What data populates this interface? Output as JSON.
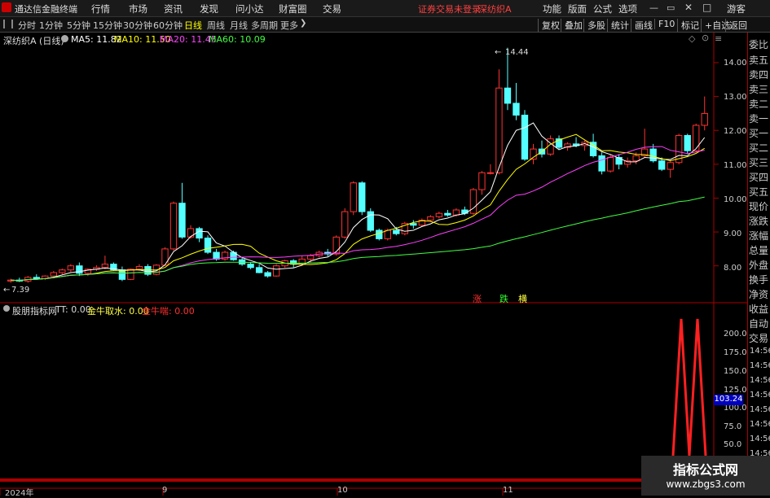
{
  "app": {
    "title": "通达信金融终端"
  },
  "menu": [
    "行情",
    "市场",
    "资讯",
    "发现",
    "问小达",
    "财富圈",
    "交易"
  ],
  "status": {
    "warning": "证券交易未登录",
    "stock": "深纺织A"
  },
  "right_menu": [
    "功能",
    "版面",
    "公式",
    "选项"
  ],
  "user": "游客",
  "periods": [
    "分时",
    "1分钟",
    "5分钟",
    "15分钟",
    "30分钟",
    "60分钟",
    "日线",
    "周线",
    "月线",
    "多周期",
    "更多"
  ],
  "active_period": "日线",
  "toolbar_right": [
    "复权",
    "叠加",
    "多股",
    "统计",
    "画线",
    "F10",
    "标记",
    "+自选",
    "返回"
  ],
  "main_chart": {
    "title": "深纺织A (日线)",
    "ma": [
      {
        "label": "MA5: 11.82",
        "color": "#ffffff"
      },
      {
        "label": "MA10: 11.50",
        "color": "#ffff00"
      },
      {
        "label": "MA20: 11.45",
        "color": "#ff40ff"
      },
      {
        "label": "MA60: 10.09",
        "color": "#40ff40"
      }
    ],
    "y_ticks": [
      "14.00",
      "13.00",
      "12.00",
      "11.00",
      "10.00",
      "9.00",
      "8.00"
    ],
    "high_label": "14.44",
    "low_label": "7.39",
    "markers": [
      {
        "text": "涨",
        "color": "#ff3030"
      },
      {
        "text": "跌",
        "color": "#30ff30"
      },
      {
        "text": "横",
        "color": "#ffff40"
      }
    ]
  },
  "sub_chart": {
    "title": "股朋指标网",
    "tt": "TT: 0.00",
    "g1": "金牛取水: 0.00",
    "g2": "金牛喘: 0.00",
    "y_ticks": [
      "200.0",
      "175.0",
      "150.0",
      "125.0",
      "100.0",
      "75.0",
      "50.0"
    ],
    "cursor_value": "103.24"
  },
  "x_labels": [
    "2024年",
    "9",
    "10",
    "11"
  ],
  "side_panel": [
    "委比",
    "卖五",
    "卖四",
    "卖三",
    "卖二",
    "卖一",
    "买一",
    "买二",
    "买三",
    "买四",
    "买五",
    "现价",
    "涨跌",
    "涨幅",
    "总量",
    "外盘",
    "换手",
    "净资",
    "收益",
    "自动",
    "交易"
  ],
  "times": [
    "14:56",
    "14:56",
    "14:56",
    "14:56",
    "14:56",
    "14:56",
    "14:56",
    "14:56"
  ],
  "watermark": {
    "line1": "指标公式网",
    "line2": "www.zbgs3.com"
  },
  "chart_data": {
    "type": "candlestick",
    "ylim": [
      7.2,
      14.6
    ],
    "candles": [
      [
        7.55,
        7.62,
        7.5,
        7.58
      ],
      [
        7.58,
        7.65,
        7.52,
        7.55
      ],
      [
        7.55,
        7.7,
        7.5,
        7.66
      ],
      [
        7.66,
        7.75,
        7.6,
        7.62
      ],
      [
        7.62,
        7.72,
        7.58,
        7.7
      ],
      [
        7.7,
        7.85,
        7.65,
        7.8
      ],
      [
        7.8,
        7.92,
        7.75,
        7.88
      ],
      [
        7.88,
        8.05,
        7.82,
        8.0
      ],
      [
        8.0,
        8.1,
        7.7,
        7.78
      ],
      [
        7.78,
        7.92,
        7.7,
        7.9
      ],
      [
        7.9,
        8.02,
        7.85,
        7.95
      ],
      [
        7.95,
        8.3,
        7.9,
        8.05
      ],
      [
        8.05,
        8.1,
        7.85,
        7.88
      ],
      [
        7.88,
        7.98,
        7.55,
        7.6
      ],
      [
        7.6,
        7.92,
        7.58,
        7.9
      ],
      [
        7.9,
        8.05,
        7.85,
        7.98
      ],
      [
        7.98,
        8.05,
        7.7,
        7.75
      ],
      [
        7.75,
        8.05,
        7.72,
        8.02
      ],
      [
        8.02,
        8.55,
        8.0,
        8.5
      ],
      [
        8.5,
        9.9,
        8.45,
        9.85
      ],
      [
        9.85,
        10.45,
        8.8,
        8.85
      ],
      [
        8.85,
        9.2,
        8.8,
        9.1
      ],
      [
        9.1,
        9.15,
        8.7,
        8.82
      ],
      [
        8.82,
        8.9,
        8.35,
        8.4
      ],
      [
        8.4,
        8.5,
        8.15,
        8.2
      ],
      [
        8.2,
        8.45,
        8.15,
        8.4
      ],
      [
        8.4,
        8.45,
        8.15,
        8.18
      ],
      [
        8.18,
        8.25,
        8.0,
        8.05
      ],
      [
        8.05,
        8.1,
        7.9,
        7.95
      ],
      [
        7.95,
        8.05,
        7.78,
        7.8
      ],
      [
        7.8,
        7.85,
        7.65,
        7.7
      ],
      [
        7.7,
        8.05,
        7.68,
        8.0
      ],
      [
        8.0,
        8.18,
        7.95,
        8.15
      ],
      [
        8.15,
        8.2,
        7.95,
        8.05
      ],
      [
        8.05,
        8.3,
        8.0,
        8.2
      ],
      [
        8.2,
        8.35,
        8.1,
        8.3
      ],
      [
        8.3,
        8.45,
        8.25,
        8.4
      ],
      [
        8.4,
        8.5,
        8.28,
        8.35
      ],
      [
        8.35,
        8.9,
        8.3,
        8.85
      ],
      [
        8.85,
        9.7,
        8.8,
        9.6
      ],
      [
        9.6,
        10.5,
        9.5,
        10.45
      ],
      [
        10.45,
        10.5,
        9.5,
        9.6
      ],
      [
        9.6,
        9.7,
        9.0,
        9.05
      ],
      [
        9.05,
        9.1,
        8.75,
        8.8
      ],
      [
        8.8,
        9.1,
        8.75,
        9.05
      ],
      [
        9.05,
        9.15,
        8.9,
        8.95
      ],
      [
        8.95,
        9.3,
        8.9,
        9.25
      ],
      [
        9.25,
        9.35,
        9.1,
        9.2
      ],
      [
        9.2,
        9.4,
        9.15,
        9.35
      ],
      [
        9.35,
        9.5,
        9.3,
        9.45
      ],
      [
        9.45,
        9.6,
        9.4,
        9.55
      ],
      [
        9.55,
        9.65,
        9.45,
        9.5
      ],
      [
        9.5,
        9.7,
        9.45,
        9.65
      ],
      [
        9.65,
        9.75,
        9.5,
        9.55
      ],
      [
        9.55,
        10.3,
        9.5,
        10.25
      ],
      [
        10.25,
        10.8,
        10.1,
        10.75
      ],
      [
        10.75,
        11.0,
        10.7,
        10.75
      ],
      [
        10.75,
        13.8,
        10.7,
        13.25
      ],
      [
        13.25,
        14.44,
        12.6,
        12.8
      ],
      [
        12.8,
        13.4,
        12.3,
        12.45
      ],
      [
        12.45,
        12.6,
        11.1,
        11.15
      ],
      [
        11.15,
        11.6,
        11.0,
        11.45
      ],
      [
        11.45,
        11.7,
        11.2,
        11.3
      ],
      [
        11.3,
        11.85,
        11.25,
        11.75
      ],
      [
        11.75,
        11.85,
        11.45,
        11.5
      ],
      [
        11.5,
        11.65,
        11.4,
        11.6
      ],
      [
        11.6,
        11.8,
        11.5,
        11.55
      ],
      [
        11.55,
        11.7,
        11.4,
        11.65
      ],
      [
        11.65,
        11.9,
        11.2,
        11.25
      ],
      [
        11.25,
        11.35,
        10.7,
        10.8
      ],
      [
        10.8,
        11.3,
        10.75,
        11.2
      ],
      [
        11.2,
        11.3,
        10.85,
        11.0
      ],
      [
        11.0,
        11.2,
        10.9,
        11.1
      ],
      [
        11.1,
        11.35,
        11.0,
        11.25
      ],
      [
        11.25,
        12.05,
        11.2,
        11.45
      ],
      [
        11.45,
        11.6,
        11.05,
        11.1
      ],
      [
        11.1,
        11.2,
        10.8,
        10.85
      ],
      [
        10.85,
        11.1,
        10.6,
        11.05
      ],
      [
        11.05,
        11.9,
        11.0,
        11.85
      ],
      [
        11.85,
        11.9,
        11.3,
        11.4
      ],
      [
        11.4,
        12.2,
        11.35,
        12.15
      ],
      [
        12.15,
        13.0,
        12.0,
        12.5
      ]
    ],
    "ma5_last": 11.82,
    "ma10_last": 11.5,
    "ma20_last": 11.45,
    "ma60_last": 10.09
  }
}
